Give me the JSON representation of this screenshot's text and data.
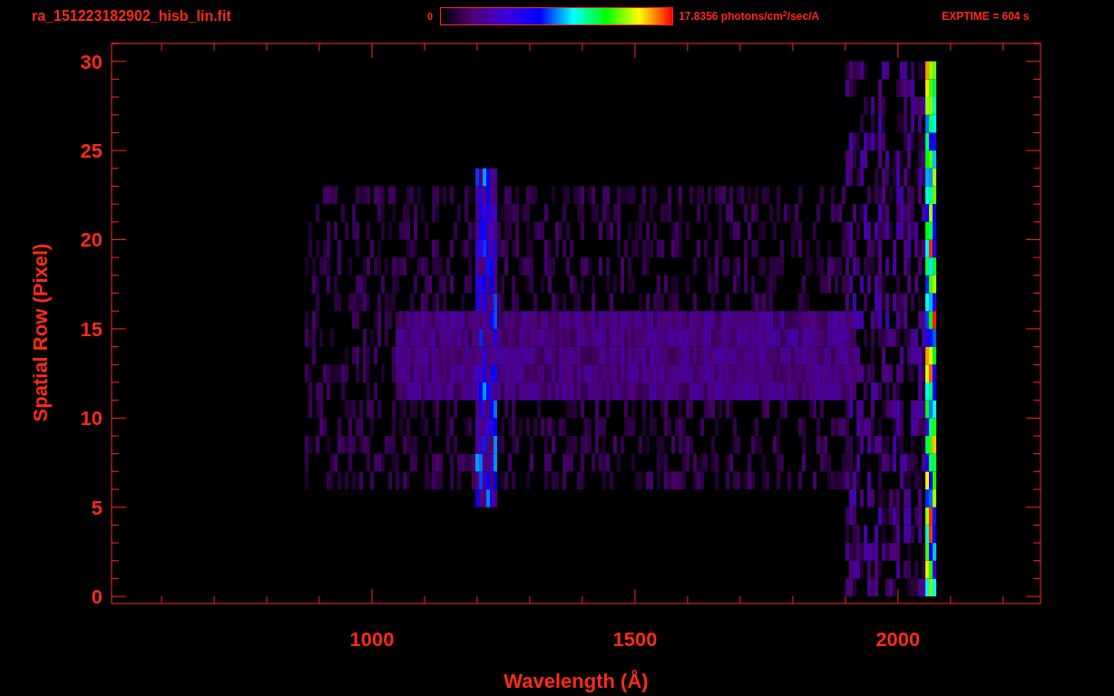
{
  "header": {
    "filename": "ra_151223182902_hisb_lin.fit",
    "colorbar": {
      "min_label": "0",
      "max_label": "17.8356 photons/cm$^{2}$/sec/A"
    },
    "exptime": "EXPTIME = 604 s"
  },
  "plot": {
    "ylabel": "Spatial Row (Pixel)",
    "xlabel": "Wavelength (Å)",
    "yticks": [
      "30",
      "25",
      "20",
      "15",
      "10",
      "5",
      "0"
    ],
    "xticks": [
      "1000",
      "1500",
      "2000"
    ]
  }
}
